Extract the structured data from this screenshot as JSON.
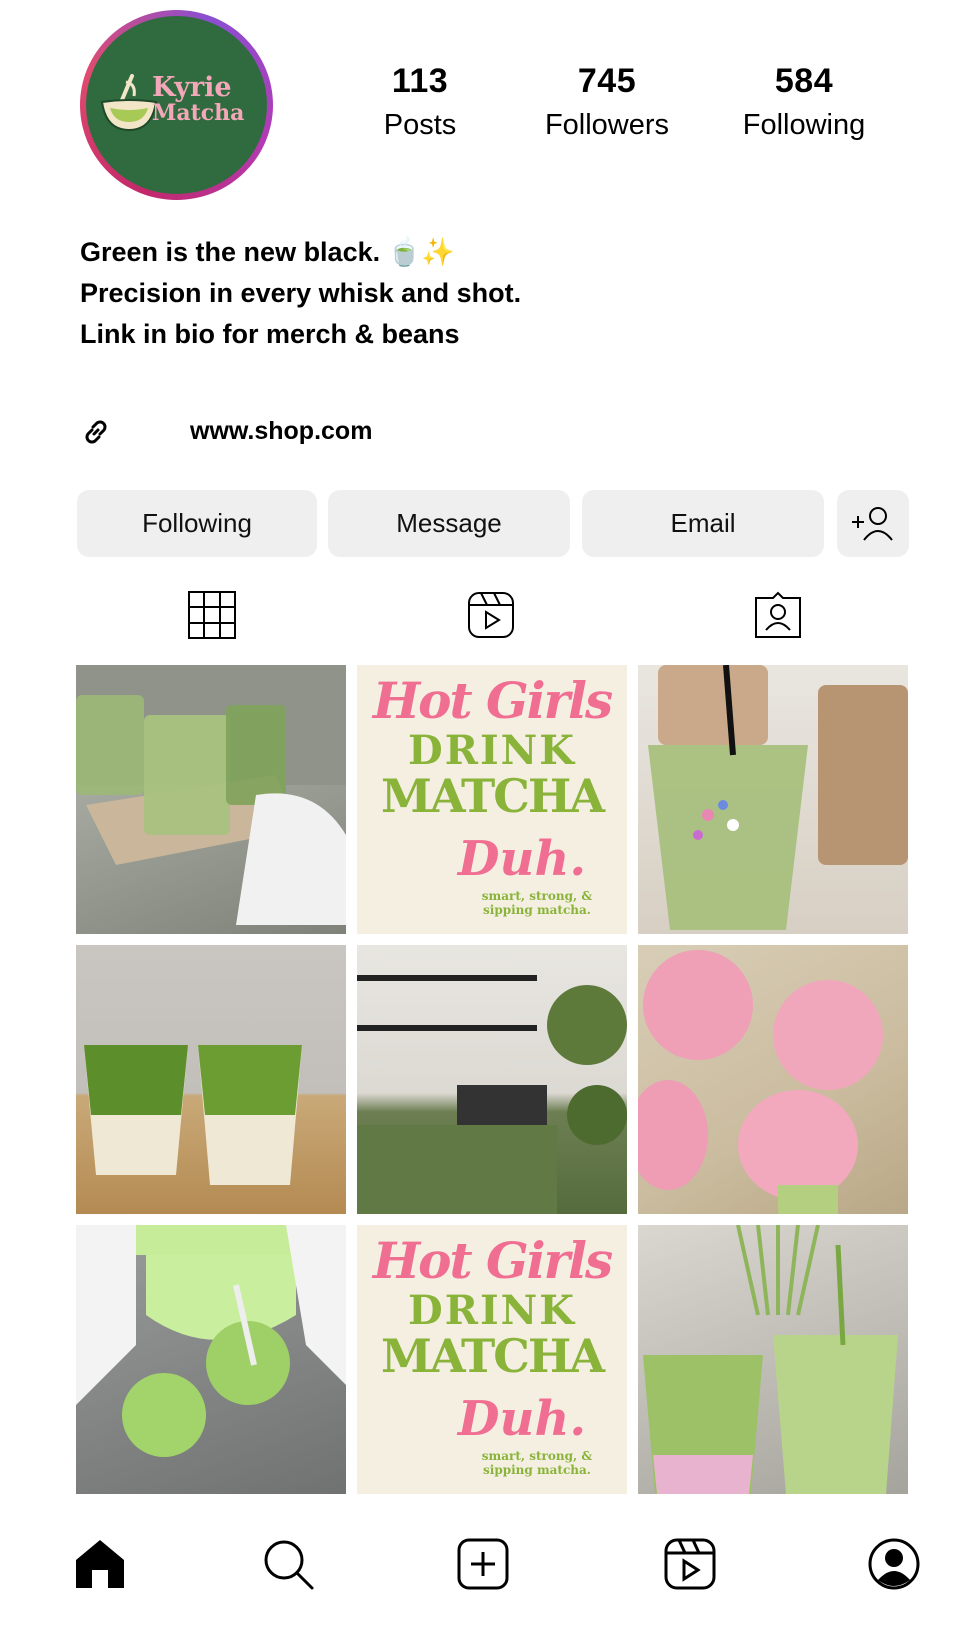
{
  "profile": {
    "logo_line1": "Kyrie",
    "logo_line2": "Matcha",
    "stats": [
      {
        "value": "113",
        "label": "Posts"
      },
      {
        "value": "745",
        "label": "Followers"
      },
      {
        "value": "584",
        "label": "Following"
      }
    ],
    "bio": [
      "Green is the new black. 🍵✨",
      "Precision in every whisk and shot.",
      "Link in bio for merch & beans"
    ],
    "link": "www.shop.com"
  },
  "actions": {
    "following": "Following",
    "message": "Message",
    "email": "Email"
  },
  "tabs": [
    "grid-icon",
    "reels-icon",
    "tagged-icon"
  ],
  "posts": [
    {
      "kind": "photo"
    },
    {
      "kind": "poster",
      "line1": "Hot Girls",
      "line2": "DRINK",
      "line3": "MATCHA",
      "line4": "Duh.",
      "line5": "smart, strong, & sipping matcha."
    },
    {
      "kind": "photo"
    },
    {
      "kind": "photo"
    },
    {
      "kind": "photo"
    },
    {
      "kind": "photo"
    },
    {
      "kind": "photo"
    },
    {
      "kind": "poster",
      "line1": "Hot Girls",
      "line2": "DRINK",
      "line3": "MATCHA",
      "line4": "Duh.",
      "line5": "smart, strong, & sipping matcha."
    },
    {
      "kind": "photo"
    }
  ],
  "nav": [
    "home-icon",
    "search-icon",
    "create-icon",
    "reels-icon",
    "profile-icon"
  ],
  "colors": {
    "logo_green": "#2f6b3e",
    "logo_pink": "#f3a7b8",
    "button_bg": "#efefef",
    "poster_pink": "#f06e92",
    "poster_green": "#8ab33a"
  }
}
